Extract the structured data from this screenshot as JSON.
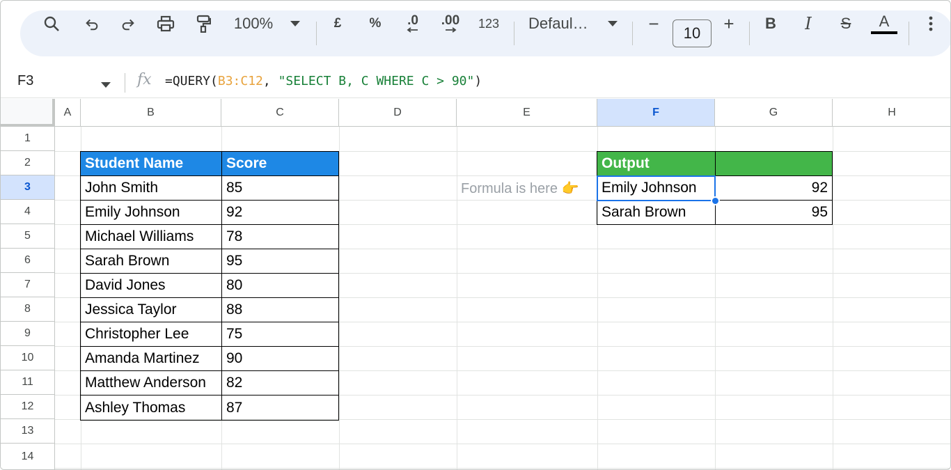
{
  "toolbar": {
    "zoom": "100%",
    "currency": "£",
    "percent": "%",
    "decrease_decimal": ".0",
    "increase_decimal": ".00",
    "number_format": "123",
    "font": "Defaul…",
    "font_size": "10",
    "minus": "−",
    "plus": "+",
    "bold": "B",
    "italic": "I",
    "strike": "S",
    "text_color": "A",
    "icons": [
      "search-icon",
      "undo-icon",
      "redo-icon",
      "print-icon",
      "paint-format-icon",
      "chevron-down-icon",
      "more-vert-icon"
    ]
  },
  "formula_bar": {
    "cell_ref": "F3",
    "fx": "fx",
    "formula_prefix": "=QUERY(",
    "formula_range": "B3:C12",
    "formula_comma": ", ",
    "formula_string": "\"SELECT B, C WHERE C > 90\"",
    "formula_suffix": ")"
  },
  "columns": [
    "A",
    "B",
    "C",
    "D",
    "E",
    "F",
    "G",
    "H"
  ],
  "rows": [
    "1",
    "2",
    "3",
    "4",
    "5",
    "6",
    "7",
    "8",
    "9",
    "10",
    "11",
    "12",
    "13",
    "14"
  ],
  "source_table": {
    "header": [
      "Student Name",
      "Score"
    ],
    "rows": [
      [
        "John Smith",
        "85"
      ],
      [
        "Emily Johnson",
        "92"
      ],
      [
        "Michael Williams",
        "78"
      ],
      [
        "Sarah Brown",
        "95"
      ],
      [
        "David Jones",
        "80"
      ],
      [
        "Jessica Taylor",
        "88"
      ],
      [
        "Christopher Lee",
        "75"
      ],
      [
        "Amanda Martinez",
        "90"
      ],
      [
        "Matthew Anderson",
        "82"
      ],
      [
        "Ashley Thomas",
        "87"
      ]
    ]
  },
  "note": "Formula is here 👉",
  "output_table": {
    "header": [
      "Output",
      ""
    ],
    "rows": [
      [
        "Emily Johnson",
        "92"
      ],
      [
        "Sarah Brown",
        "95"
      ]
    ]
  },
  "colors": {
    "header_blue": "#1e88e5",
    "header_green": "#43b649",
    "selection": "#1a73e8"
  }
}
